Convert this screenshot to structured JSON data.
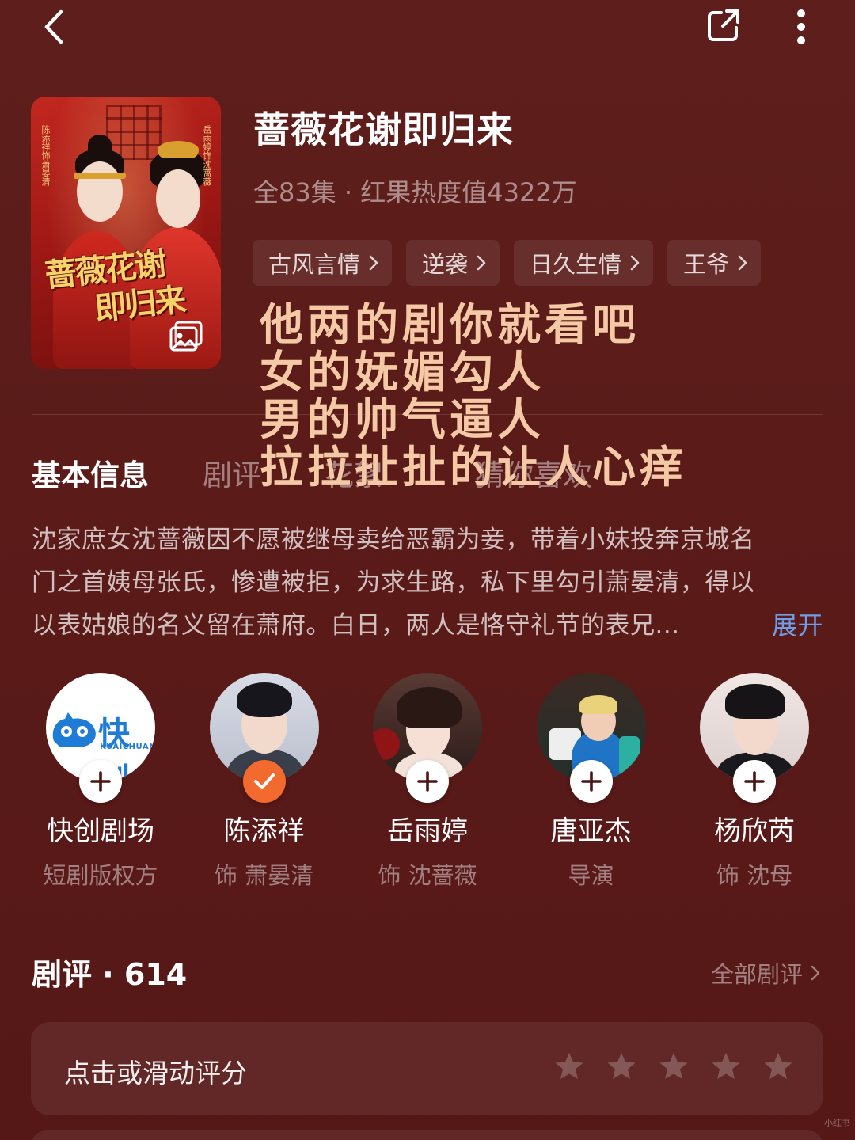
{
  "drama": {
    "title": "蔷薇花谢即归来",
    "meta": "全83集 · 红果热度值4322万",
    "poster": {
      "title_line1": "蔷薇花谢",
      "title_line2": "即归来",
      "side_left": "陈添祥饰萧晏清",
      "side_right": "岳雨婷饰沈蔷薇"
    },
    "tags": [
      {
        "label": "古风言情"
      },
      {
        "label": "逆袭"
      },
      {
        "label": "日久生情"
      },
      {
        "label": "王爷"
      }
    ]
  },
  "overlay_caption": [
    "他两的剧你就看吧",
    "女的妩媚勾人",
    "男的帅气逼人",
    "拉拉扯扯的让人心痒"
  ],
  "tabs": [
    {
      "label": "基本信息",
      "active": true
    },
    {
      "label": "剧评",
      "active": false
    },
    {
      "label": "花絮",
      "active": false
    },
    {
      "label": "猜你喜欢",
      "active": false
    }
  ],
  "synopsis": {
    "lines": [
      "沈家庶女沈蔷薇因不愿被继母卖给恶霸为妾，带着小妹投奔京城名",
      "门之首姨母张氏，惨遭被拒，为求生路，私下里勾引萧晏清，得以",
      "以表姑娘的名义留在萧府。白日，两人是恪守礼节的表兄..."
    ],
    "expand_label": "展开"
  },
  "cast": [
    {
      "name": "快创剧场",
      "role": "短剧版权方",
      "followed": false,
      "logo_text": "快创",
      "logo_sub": "KUAICHUANG"
    },
    {
      "name": "陈添祥",
      "role": "饰 萧晏清",
      "followed": true
    },
    {
      "name": "岳雨婷",
      "role": "饰 沈蔷薇",
      "followed": false
    },
    {
      "name": "唐亚杰",
      "role": "导演",
      "followed": false
    },
    {
      "name": "杨欣芮",
      "role": "饰 沈母",
      "followed": false
    }
  ],
  "reviews": {
    "title": "剧评 · 614",
    "all_label": "全部剧评",
    "rate_prompt": "点击或滑动评分",
    "star_count": 5,
    "rating": 0
  },
  "icons": {
    "back": "chevron-left-icon",
    "share": "share-icon",
    "more": "more-vertical-icon",
    "gallery": "gallery-icon",
    "follow": "plus-icon",
    "followed": "check-icon",
    "star": "star-icon"
  },
  "colors": {
    "background": "#5c1d1a",
    "accent_link": "#6f9de8",
    "followed_badge": "#f26a2e",
    "poster_title": "#f6d26a",
    "caption": "#f6c9a6"
  },
  "watermark": "小红书"
}
